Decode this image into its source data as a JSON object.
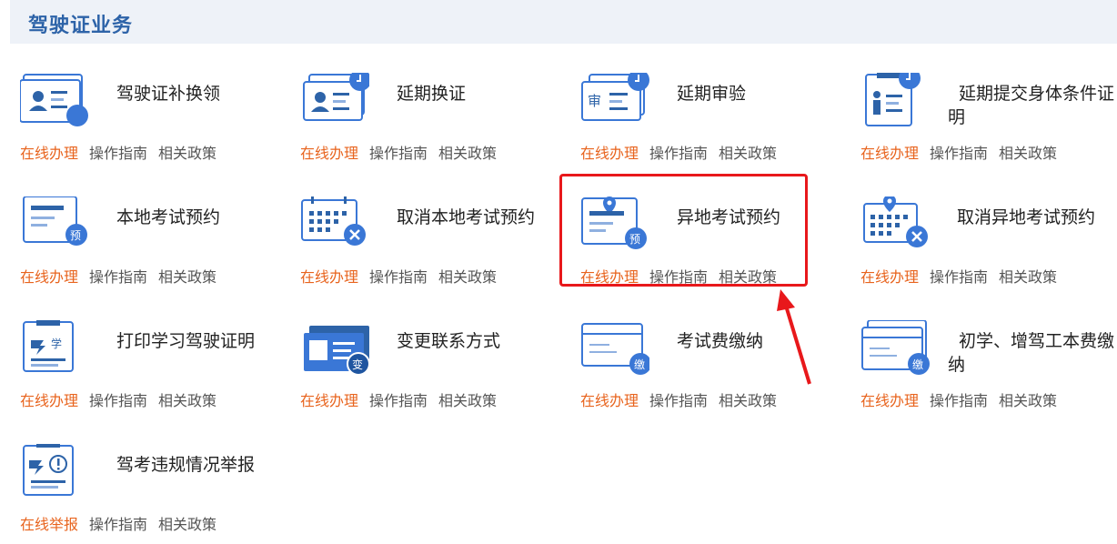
{
  "header": {
    "title": "驾驶证业务"
  },
  "colors": {
    "accent": "#2d63a8",
    "action": "#e8641e",
    "highlight": "#e8181b",
    "icon_blue": "#3a77d6"
  },
  "services": [
    {
      "title": "驾驶证补换领",
      "primary": "在线办理",
      "guide": "操作指南",
      "policy": "相关政策",
      "icon": "id-card-clock-icon"
    },
    {
      "title": "延期换证",
      "primary": "在线办理",
      "guide": "操作指南",
      "policy": "相关政策",
      "icon": "id-card-clock-icon"
    },
    {
      "title": "延期审验",
      "primary": "在线办理",
      "guide": "操作指南",
      "policy": "相关政策",
      "icon": "review-card-clock-icon"
    },
    {
      "title": "延期提交身体条件证明",
      "primary": "在线办理",
      "guide": "操作指南",
      "policy": "相关政策",
      "icon": "health-doc-clock-icon"
    },
    {
      "title": "本地考试预约",
      "primary": "在线办理",
      "guide": "操作指南",
      "policy": "相关政策",
      "icon": "exam-booking-icon",
      "badge": "预"
    },
    {
      "title": "取消本地考试预约",
      "primary": "在线办理",
      "guide": "操作指南",
      "policy": "相关政策",
      "icon": "calendar-cancel-icon"
    },
    {
      "title": "异地考试预约",
      "primary": "在线办理",
      "guide": "操作指南",
      "policy": "相关政策",
      "icon": "location-booking-icon",
      "badge": "预"
    },
    {
      "title": "取消异地考试预约",
      "primary": "在线办理",
      "guide": "操作指南",
      "policy": "相关政策",
      "icon": "location-calendar-cancel-icon"
    },
    {
      "title": "打印学习驾驶证明",
      "primary": "在线办理",
      "guide": "操作指南",
      "policy": "相关政策",
      "icon": "learner-doc-icon",
      "badge": "学"
    },
    {
      "title": "变更联系方式",
      "primary": "在线办理",
      "guide": "操作指南",
      "policy": "相关政策",
      "icon": "contact-change-icon",
      "badge": "变"
    },
    {
      "title": "考试费缴纳",
      "primary": "在线办理",
      "guide": "操作指南",
      "policy": "相关政策",
      "icon": "fee-card-icon",
      "badge": "缴"
    },
    {
      "title": "初学、增驾工本费缴纳",
      "primary": "在线办理",
      "guide": "操作指南",
      "policy": "相关政策",
      "icon": "fee-cards-icon",
      "badge": "缴"
    },
    {
      "title": "驾考违规情况举报",
      "primary": "在线举报",
      "guide": "操作指南",
      "policy": "相关政策",
      "icon": "violation-report-icon"
    }
  ]
}
